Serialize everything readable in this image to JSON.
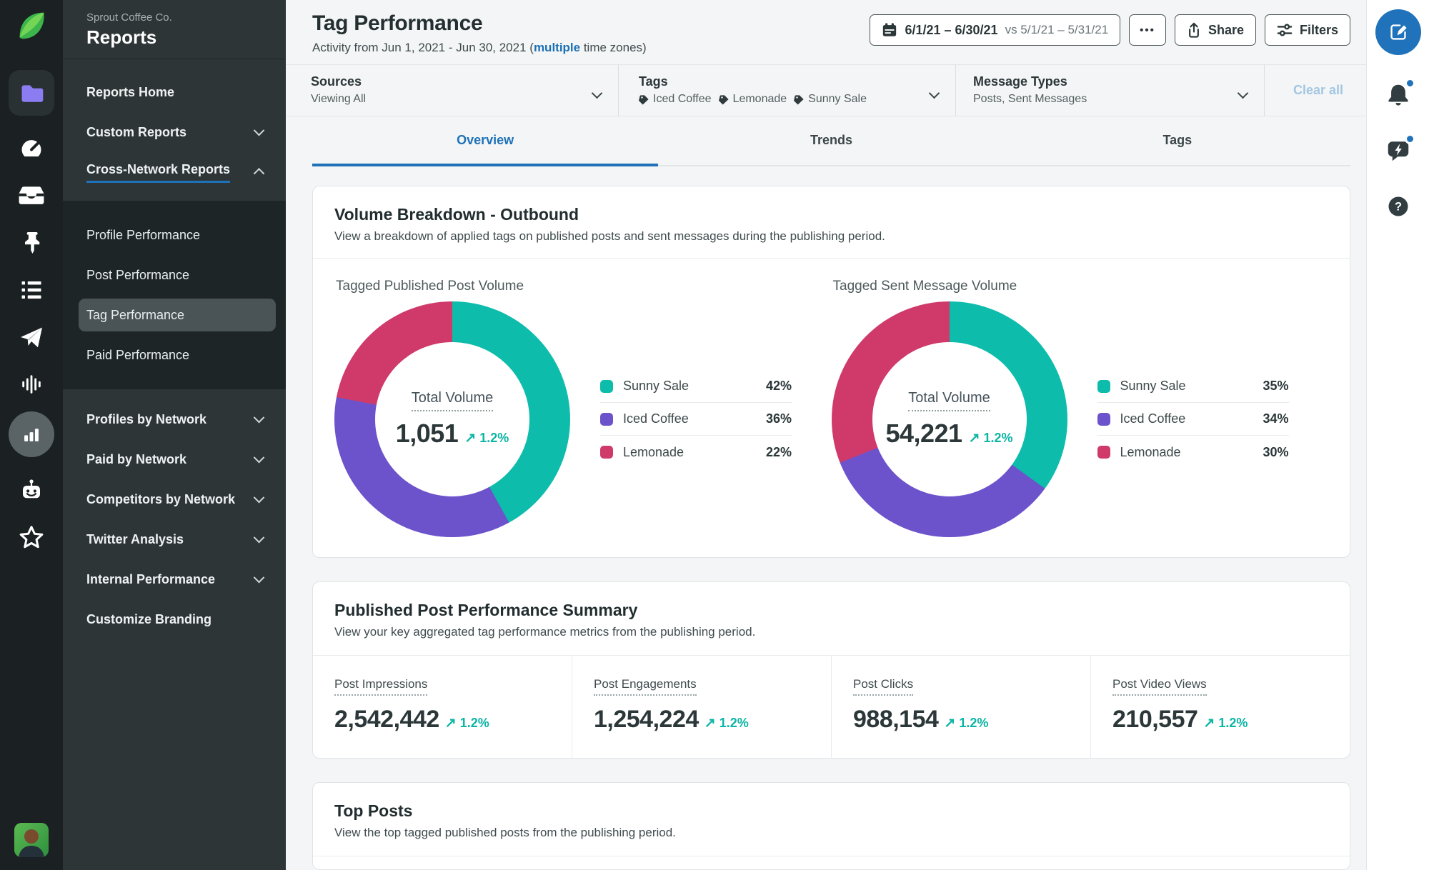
{
  "colors": {
    "accent_blue": "#1f72b8",
    "teal": "#0db5a5",
    "purple": "#6d53cb",
    "pink": "#cf3a6b"
  },
  "icons": {
    "trend_up": "↗"
  },
  "sidebar": {
    "org": "Sprout Coffee Co.",
    "title": "Reports",
    "items": [
      {
        "label": "Reports Home"
      },
      {
        "label": "Custom Reports"
      },
      {
        "label": "Cross-Network Reports"
      }
    ],
    "subitems": [
      "Profile Performance",
      "Post Performance",
      "Tag Performance",
      "Paid Performance"
    ],
    "active_subitem": "Tag Performance",
    "lower": [
      "Profiles by Network",
      "Paid by Network",
      "Competitors by Network",
      "Twitter Analysis",
      "Internal Performance",
      "Customize Branding"
    ]
  },
  "header": {
    "title": "Tag Performance",
    "subtitle_prefix": "Activity from Jun 1, 2021 - Jun 30, 2021 (",
    "subtitle_link": "multiple",
    "subtitle_suffix": " time zones)",
    "date_range": "6/1/21 – 6/30/21",
    "date_compare": "vs 5/1/21 – 5/31/21",
    "more_label": "•••",
    "share_label": "Share",
    "filters_label": "Filters"
  },
  "filter_bar": {
    "sources": {
      "label": "Sources",
      "value": "Viewing All"
    },
    "tags": {
      "label": "Tags",
      "values": [
        "Iced Coffee",
        "Lemonade",
        "Sunny Sale"
      ]
    },
    "message_types": {
      "label": "Message Types",
      "value": "Posts, Sent Messages"
    },
    "clear_all": "Clear all"
  },
  "tabs": [
    {
      "label": "Overview",
      "active": true
    },
    {
      "label": "Trends",
      "active": false
    },
    {
      "label": "Tags",
      "active": false
    }
  ],
  "volume_breakdown": {
    "title": "Volume Breakdown - Outbound",
    "subtitle": "View a breakdown of applied tags on published posts and sent messages during the publishing period."
  },
  "chart_data": [
    {
      "type": "pie",
      "title": "Tagged Published Post Volume",
      "center_label": "Total Volume",
      "total": "1,051",
      "change": "1.2%",
      "slices": [
        {
          "name": "Sunny Sale",
          "pct": 42,
          "pct_label": "42%",
          "color": "#0dbcab"
        },
        {
          "name": "Iced Coffee",
          "pct": 36,
          "pct_label": "36%",
          "color": "#6d53cb"
        },
        {
          "name": "Lemonade",
          "pct": 22,
          "pct_label": "22%",
          "color": "#cf3a6b"
        }
      ]
    },
    {
      "type": "pie",
      "title": "Tagged Sent Message Volume",
      "center_label": "Total Volume",
      "total": "54,221",
      "change": "1.2%",
      "slices": [
        {
          "name": "Sunny Sale",
          "pct": 35,
          "pct_label": "35%",
          "color": "#0dbcab"
        },
        {
          "name": "Iced Coffee",
          "pct": 34,
          "pct_label": "34%",
          "color": "#6d53cb"
        },
        {
          "name": "Lemonade",
          "pct": 31,
          "pct_label": "30%",
          "color": "#cf3a6b"
        }
      ]
    }
  ],
  "summary": {
    "title": "Published Post Performance Summary",
    "subtitle": "View your key aggregated tag performance metrics from the publishing period.",
    "metrics": [
      {
        "label": "Post Impressions",
        "value": "2,542,442",
        "change": "1.2%"
      },
      {
        "label": "Post Engagements",
        "value": "1,254,224",
        "change": "1.2%"
      },
      {
        "label": "Post Clicks",
        "value": "988,154",
        "change": "1.2%"
      },
      {
        "label": "Post Video Views",
        "value": "210,557",
        "change": "1.2%"
      }
    ]
  },
  "top_posts": {
    "title": "Top Posts",
    "subtitle": "View the top tagged published posts from the publishing period."
  }
}
